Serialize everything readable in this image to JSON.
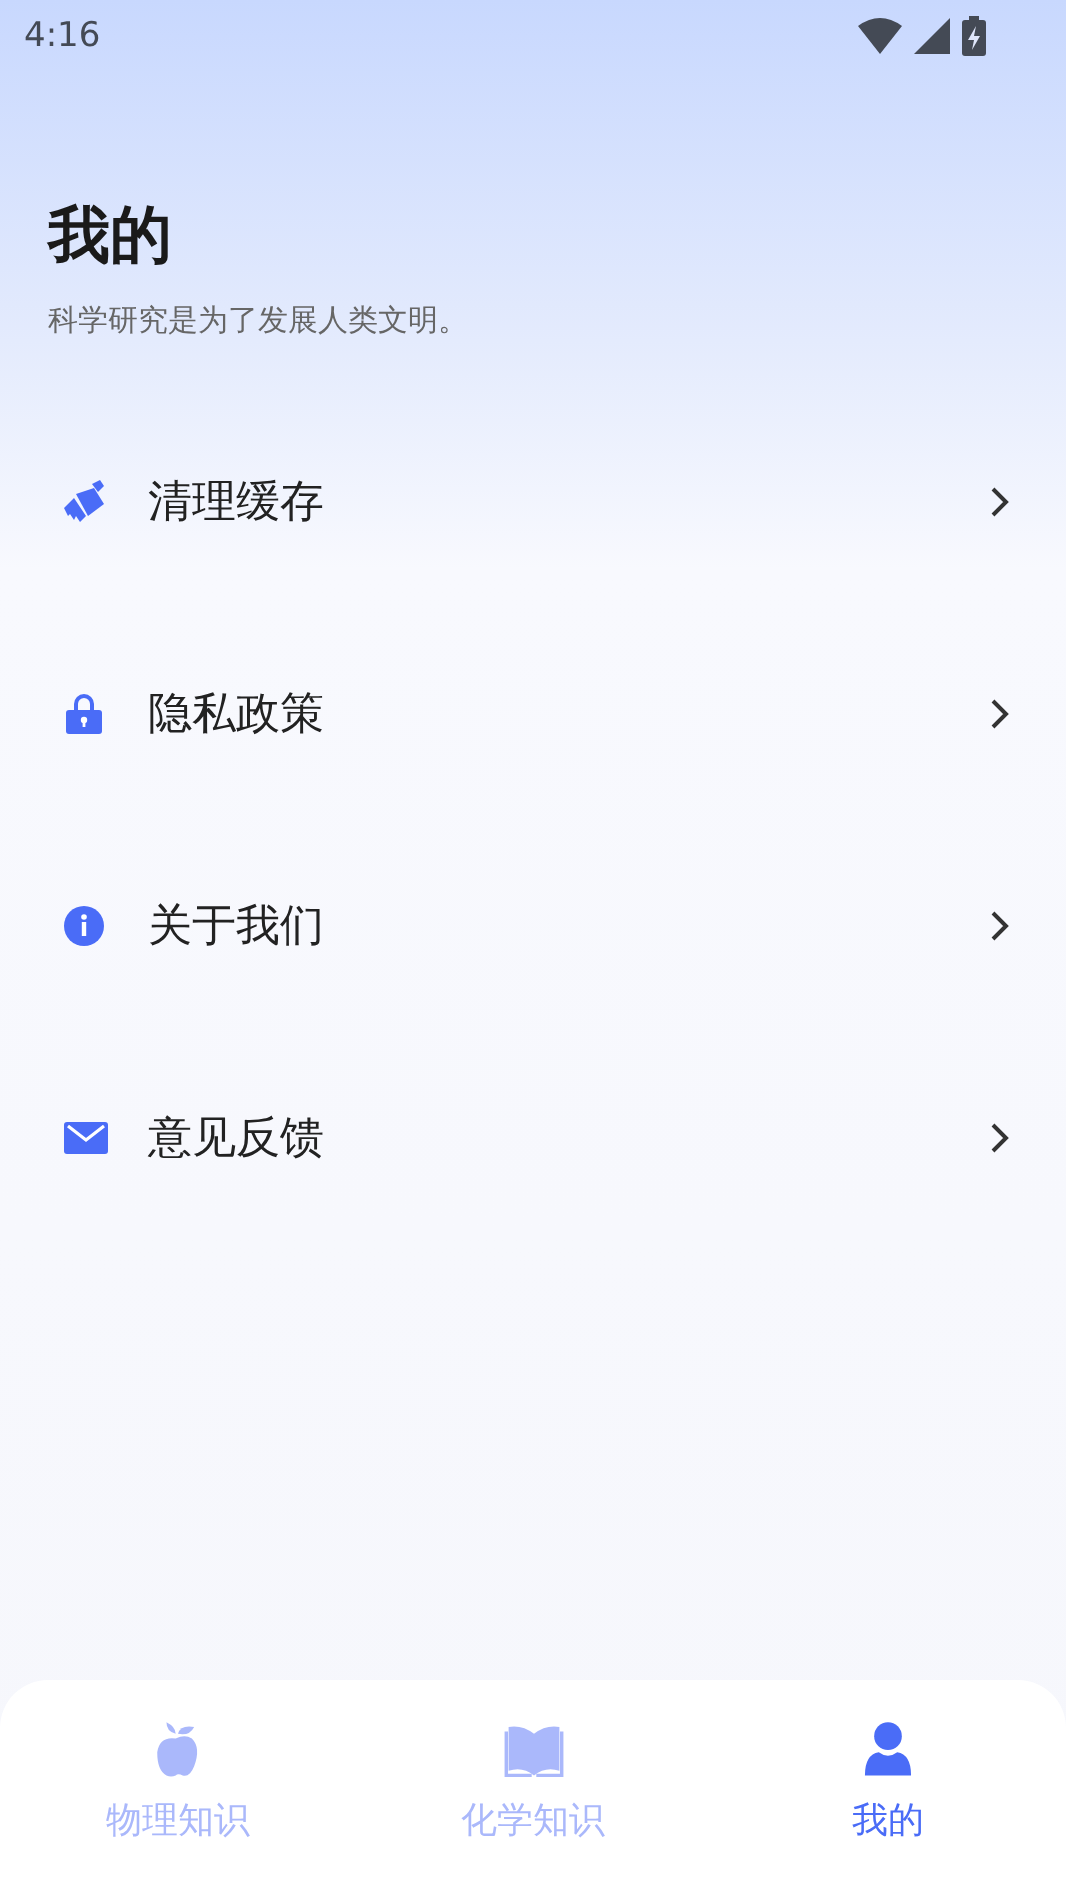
{
  "status_bar": {
    "time": "4:16"
  },
  "header": {
    "title": "我的",
    "subtitle": "科学研究是为了发展人类文明。"
  },
  "menu": [
    {
      "kind": "broom",
      "label": "清理缓存"
    },
    {
      "kind": "lock",
      "label": "隐私政策"
    },
    {
      "kind": "info",
      "label": "关于我们"
    },
    {
      "kind": "mail",
      "label": "意见反馈"
    }
  ],
  "tabs": [
    {
      "kind": "apple",
      "label": "物理知识",
      "selected": false
    },
    {
      "kind": "book",
      "label": "化学知识",
      "selected": false
    },
    {
      "kind": "person",
      "label": "我的",
      "selected": true
    }
  ]
}
